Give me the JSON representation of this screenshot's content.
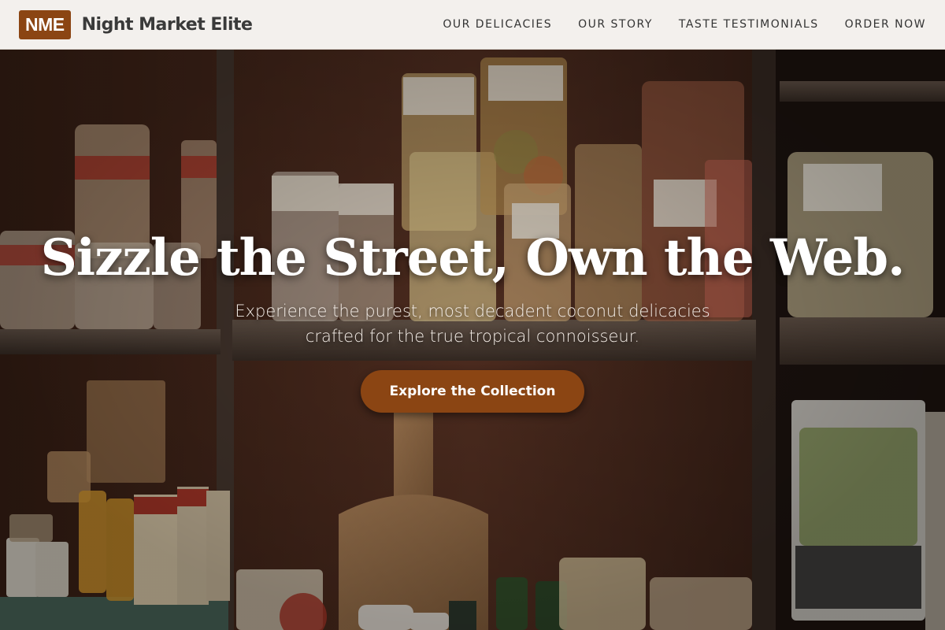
{
  "header": {
    "logo_text": "NME",
    "brand_name": "Night Market Elite",
    "nav": [
      "OUR DELICACIES",
      "OUR STORY",
      "TASTE TESTIMONIALS",
      "ORDER NOW"
    ]
  },
  "hero": {
    "title": "Sizzle the Street, Own the Web.",
    "subtitle": "Experience the purest, most decadent coconut delicacies crafted for the true tropical connoisseur.",
    "cta_label": "Explore the Collection",
    "background_image": "pasta-shop-shelves-photo"
  },
  "colors": {
    "accent": "#8B4513",
    "header_bg": "#F3F0ED",
    "text_dark": "#333333"
  }
}
